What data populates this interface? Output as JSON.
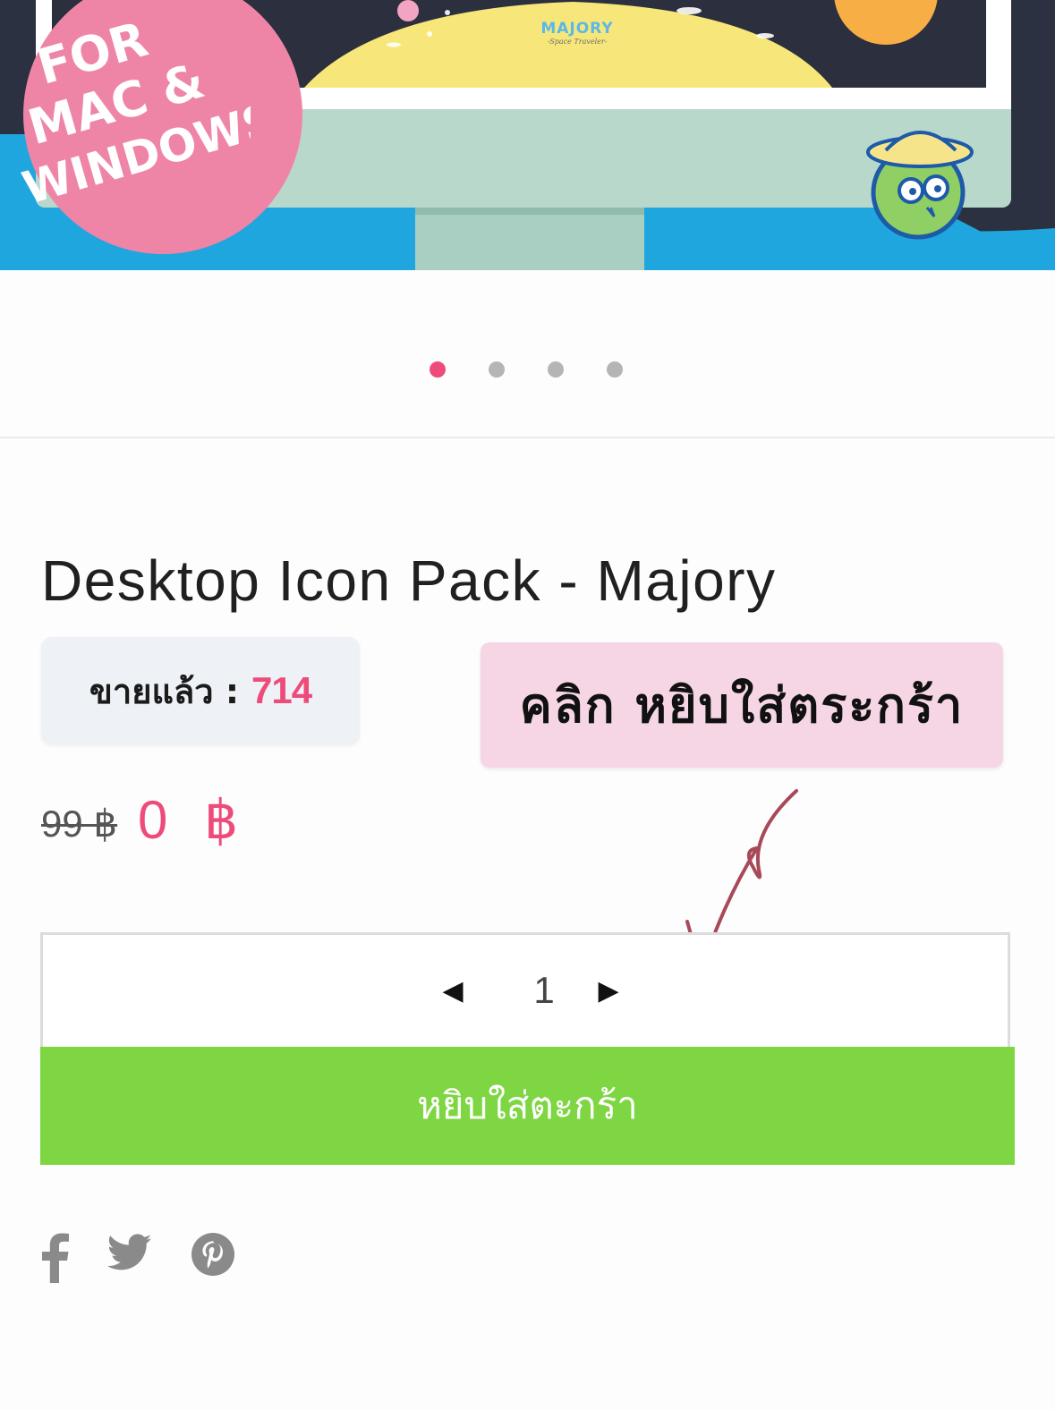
{
  "hero": {
    "badge_lines": [
      "FOR",
      "MAC &",
      "WINDOWS"
    ],
    "brand_name": "MAJORY",
    "brand_tagline": "-Space Traveler-"
  },
  "carousel": {
    "slide_count": 4,
    "active_index": 0
  },
  "product": {
    "title": "Desktop Icon Pack - Majory",
    "sold_label": "ขายแล้ว :",
    "sold_count": "714",
    "callout": "คลิก หยิบใส่ตระกร้า",
    "price_old": "99 ฿",
    "price_new": "0 ฿"
  },
  "quantity": {
    "decrement_glyph": "◀",
    "value": "1",
    "increment_glyph": "▶"
  },
  "cart": {
    "button_label": "หยิบใส่ตะกร้า"
  },
  "share": {
    "icons": [
      "facebook-icon",
      "twitter-icon",
      "pinterest-icon"
    ]
  },
  "colors": {
    "accent": "#ee4b7a",
    "cart_green": "#7ed642",
    "callout_pink": "#f6d6e5",
    "sold_bg": "#eef1f6",
    "arrow": "#a8495a"
  }
}
